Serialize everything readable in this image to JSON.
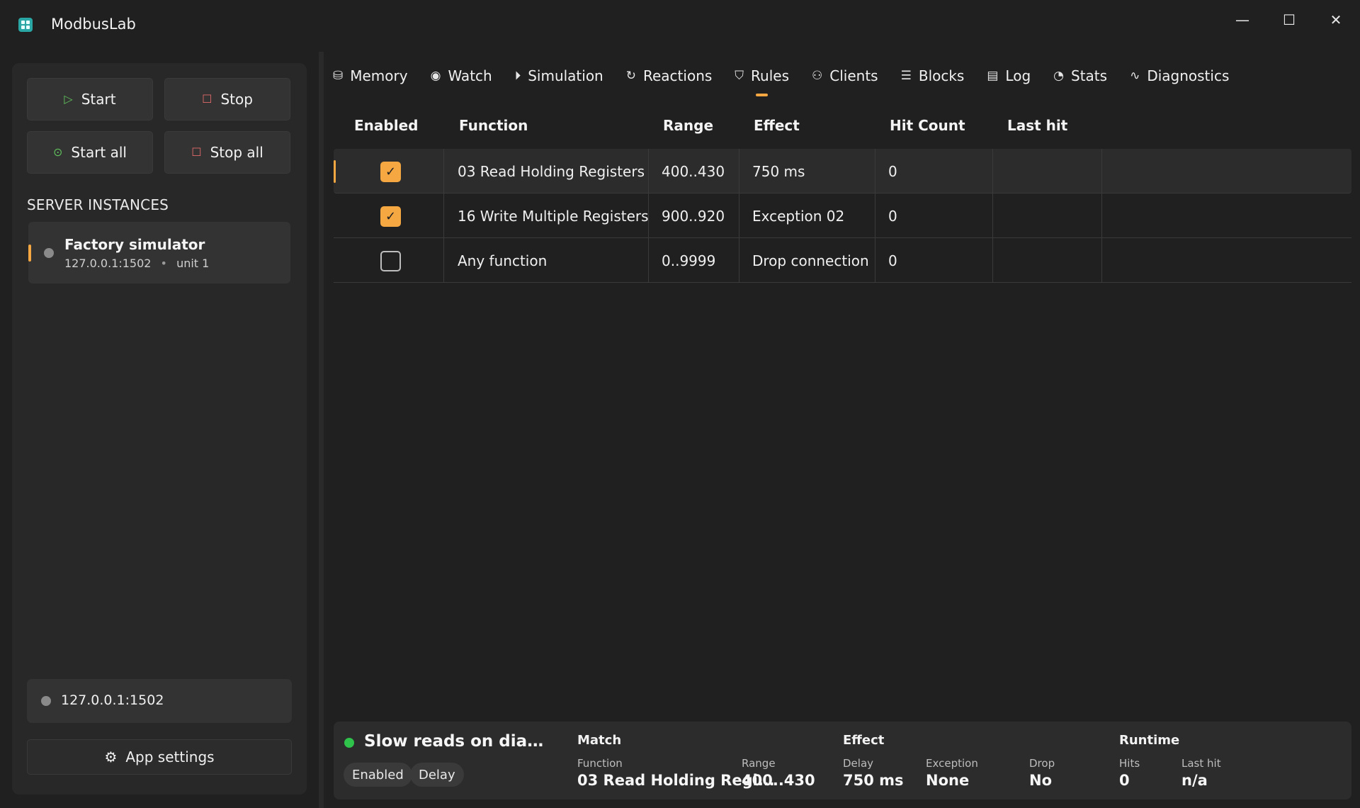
{
  "app": {
    "title": "ModbusLab"
  },
  "window": {
    "minimize": "—",
    "maximize": "☐",
    "close": "✕"
  },
  "sidebar": {
    "start_label": "Start",
    "stop_label": "Stop",
    "start_all_label": "Start all",
    "stop_all_label": "Stop all",
    "section_title": "SERVER INSTANCES",
    "instance": {
      "name": "Factory simulator",
      "address": "127.0.0.1:1502",
      "separator": "•",
      "unit": "unit 1"
    },
    "endpoint": "127.0.0.1:1502",
    "settings_label": "App settings"
  },
  "tabs": [
    {
      "label": "Memory",
      "icon": "database-icon"
    },
    {
      "label": "Watch",
      "icon": "eye-icon"
    },
    {
      "label": "Simulation",
      "icon": "play-circle-icon"
    },
    {
      "label": "Reactions",
      "icon": "refresh-icon"
    },
    {
      "label": "Rules",
      "icon": "shield-icon",
      "active": true
    },
    {
      "label": "Clients",
      "icon": "users-icon"
    },
    {
      "label": "Blocks",
      "icon": "list-icon"
    },
    {
      "label": "Log",
      "icon": "document-icon"
    },
    {
      "label": "Stats",
      "icon": "stats-icon"
    },
    {
      "label": "Diagnostics",
      "icon": "pulse-icon"
    }
  ],
  "table": {
    "headers": [
      "Enabled",
      "Function",
      "Range",
      "Effect",
      "Hit Count",
      "Last hit"
    ],
    "rows": [
      {
        "enabled": true,
        "function": "03 Read Holding Registers",
        "range": "400..430",
        "effect": "750 ms",
        "hits": "0",
        "last_hit": ""
      },
      {
        "enabled": true,
        "function": "16 Write Multiple Registers",
        "range": "900..920",
        "effect": "Exception 02",
        "hits": "0",
        "last_hit": ""
      },
      {
        "enabled": false,
        "function": "Any function",
        "range": "0..9999",
        "effect": "Drop connection",
        "hits": "0",
        "last_hit": ""
      }
    ]
  },
  "detail": {
    "title": "Slow reads on diagno...",
    "chips": [
      "Enabled",
      "Delay"
    ],
    "match": {
      "title": "Match",
      "function_label": "Function",
      "function_value": "03 Read Holding Regi...",
      "range_label": "Range",
      "range_value": "400..430"
    },
    "effect": {
      "title": "Effect",
      "delay_label": "Delay",
      "delay_value": "750 ms",
      "exception_label": "Exception",
      "exception_value": "None",
      "drop_label": "Drop",
      "drop_value": "No"
    },
    "runtime": {
      "title": "Runtime",
      "hits_label": "Hits",
      "hits_value": "0",
      "last_hit_label": "Last hit",
      "last_hit_value": "n/a"
    }
  },
  "colors": {
    "accent": "#f5a742",
    "running": "#2fc34b",
    "start": "#5fbf5b",
    "stop": "#e36a6a"
  }
}
